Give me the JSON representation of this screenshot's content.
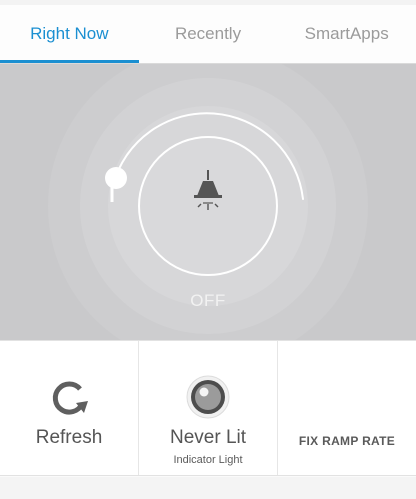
{
  "tabs": [
    {
      "label": "Right Now",
      "active": true
    },
    {
      "label": "Recently",
      "active": false
    },
    {
      "label": "SmartApps",
      "active": false
    }
  ],
  "dial": {
    "state_label": "OFF",
    "icon": "lamp-icon",
    "level_percent": 0,
    "accent_color": "#ffffff",
    "background_color": "#c9c9cb"
  },
  "tiles": {
    "refresh": {
      "label": "Refresh",
      "icon": "refresh-icon"
    },
    "indicator": {
      "label": "Never Lit",
      "sublabel": "Indicator Light",
      "icon": "indicator-light-icon"
    },
    "ramp": {
      "label": "FIX RAMP RATE"
    }
  },
  "colors": {
    "active_tab": "#1b8fd1",
    "inactive_tab": "#9b9b9b"
  }
}
